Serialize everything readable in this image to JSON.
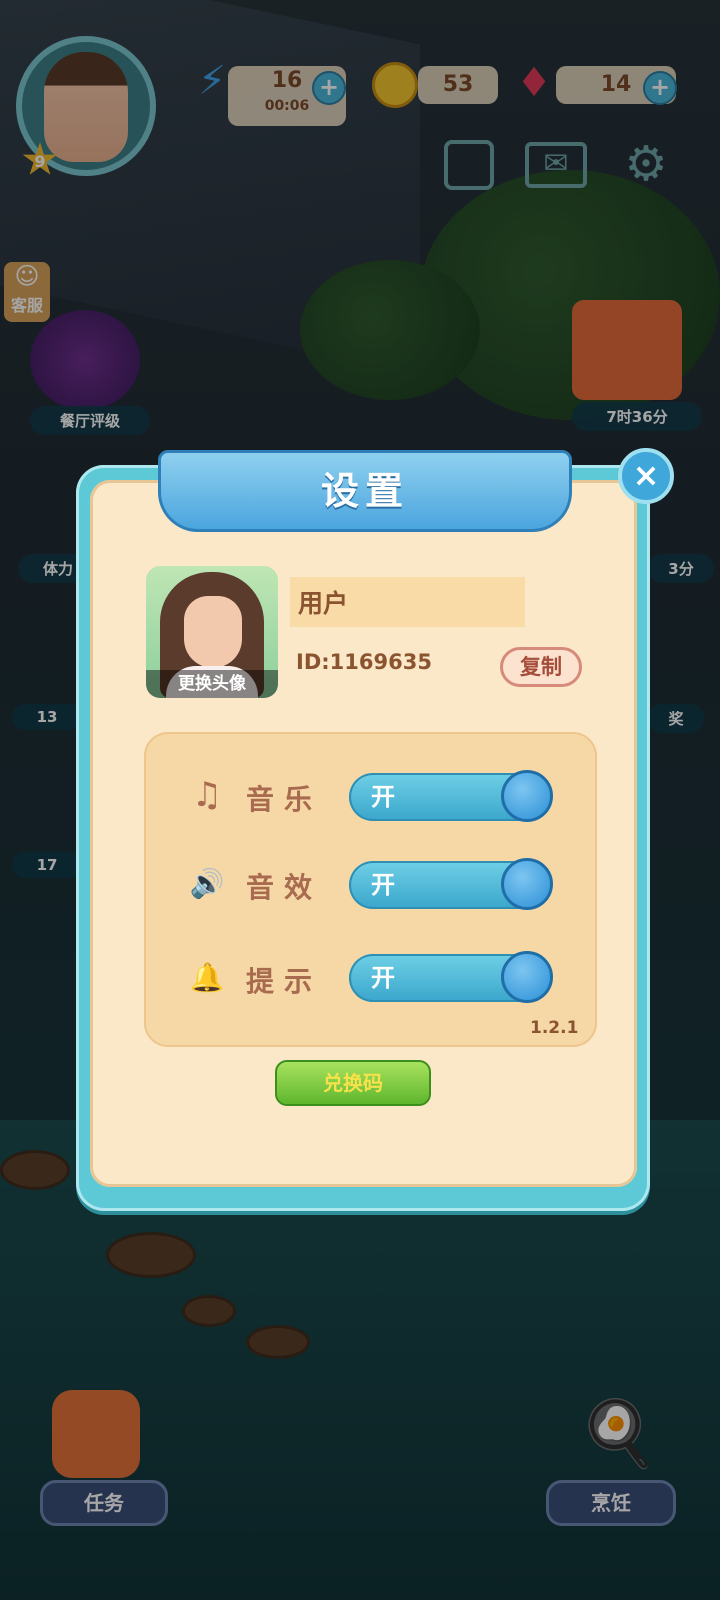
{
  "hud": {
    "energy": "16",
    "energy_timer": "00:06",
    "coins": "53",
    "gems": "14",
    "level": "9",
    "support_label": "客服",
    "rating_label": "餐厅评级",
    "stamina_label": "体力",
    "timer_right_1": "7时36分",
    "timer_right_2": "3分",
    "timer_left_1": "13",
    "timer_left_2": "17",
    "reward_label": "奖"
  },
  "bottom": {
    "tasks_label": "任务",
    "cooking_label": "烹饪"
  },
  "dialog": {
    "title": "设置",
    "close_icon": "×",
    "avatar_caption": "更换头像",
    "username": "用户",
    "user_id": "ID:1169635",
    "copy_label": "复制",
    "settings": [
      {
        "icon": "♫",
        "label": "音乐",
        "state": "开"
      },
      {
        "icon": "🔊",
        "label": "音效",
        "state": "开"
      },
      {
        "icon": "🔔",
        "label": "提示",
        "state": "开"
      }
    ],
    "version": "1.2.1",
    "redeem_label": "兑换码"
  },
  "colors": {
    "dialog_border": "#5ec9d6",
    "panel": "#fbe8c8",
    "toggle_on": "#3aa6cc",
    "redeem": "#5fb62e"
  }
}
